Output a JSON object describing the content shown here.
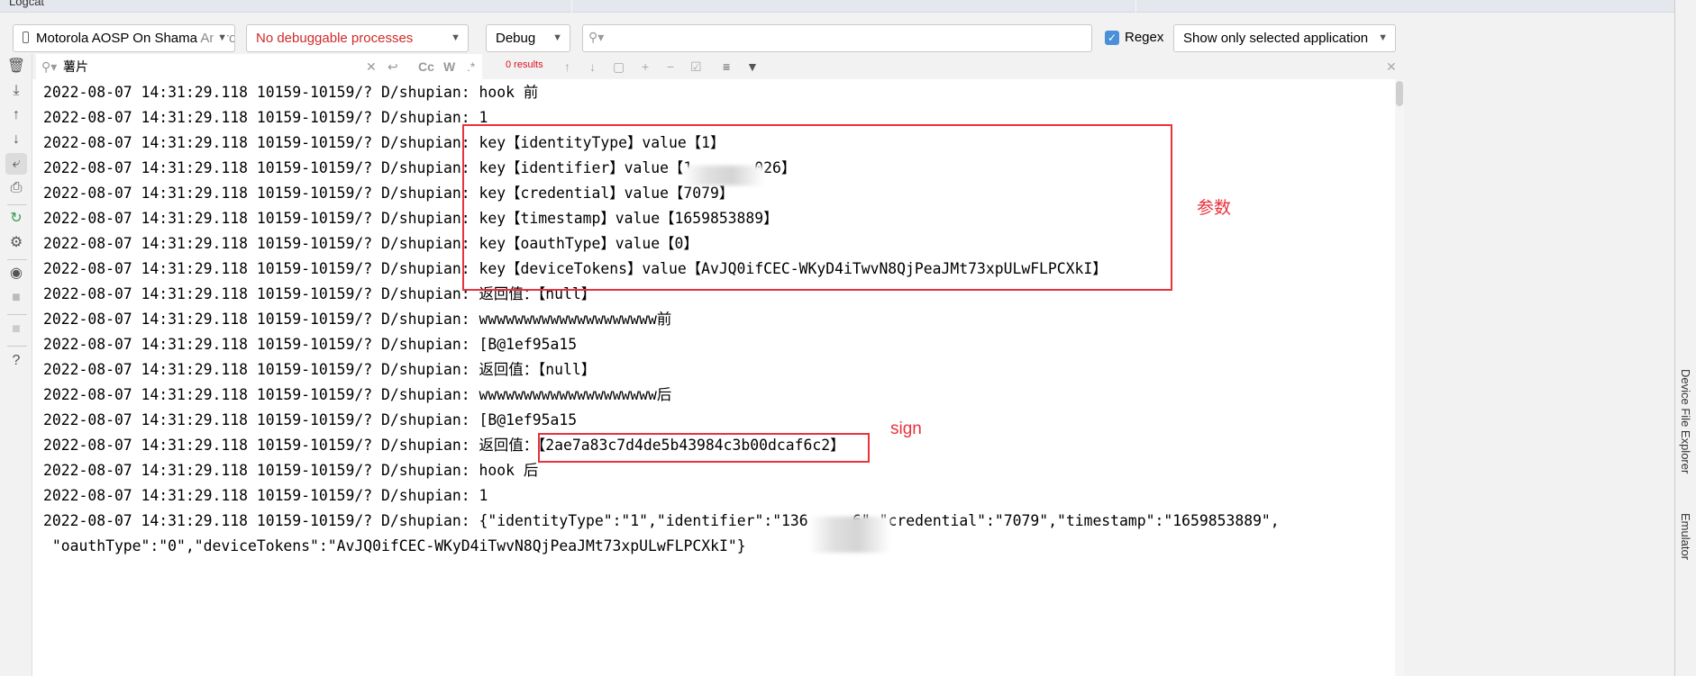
{
  "panel_title": "Logcat",
  "toolbar": {
    "device_main": "Motorola AOSP On Shama ",
    "device_dim": "Andro",
    "process": "No debuggable processes",
    "process_color": "#d12a2a",
    "level": "Debug",
    "search_value": "",
    "regex_label": "Regex",
    "regex_checked": true,
    "app_filter": "Show only selected application"
  },
  "filter": {
    "query": "薯片",
    "results": "0 results"
  },
  "sidebar_icons": [
    "trash-icon",
    "scroll-to-end-icon",
    "up-arrow-icon",
    "down-arrow-icon",
    "soft-wrap-icon",
    "print-icon",
    "restart-icon",
    "settings-icon",
    "screenshot-icon",
    "screen-record-icon",
    "stop-icon",
    "help-icon"
  ],
  "log_prefix": "2022-08-07 14:31:29.118 10159-10159/? D/shupian: ",
  "log_lines": [
    "hook 前",
    "1",
    "key【identityType】value【1】",
    "key【identifier】value【1       026】",
    "key【credential】value【7079】",
    "key【timestamp】value【1659853889】",
    "key【oauthType】value【0】",
    "key【deviceTokens】value【AvJQ0ifCEC-WKyD4iTwvN8QjPeaJMt73xpULwFLPCXkI】",
    "返回值：【null】",
    "wwwwwwwwwwwwwwwwwwww前",
    "[B@1ef95a15",
    "返回值：【null】",
    "wwwwwwwwwwwwwwwwwwww后",
    "[B@1ef95a15",
    "返回值：【2ae7a83c7d4de5b43984c3b00dcaf6c2】",
    "hook 后",
    "1",
    "{\"identityType\":\"1\",\"identifier\":\"136     6\",\"credential\":\"7079\",\"timestamp\":\"1659853889\","
  ],
  "log_continuation": " \"oauthType\":\"0\",\"deviceTokens\":\"AvJQ0ifCEC-WKyD4iTwvN8QjPeaJMt73xpULwFLPCXkI\"}",
  "annotations": {
    "params": "参数",
    "sign": "sign",
    "color": "#e8323c"
  },
  "side_tabs": [
    "Device File Explorer",
    "Emulator"
  ]
}
